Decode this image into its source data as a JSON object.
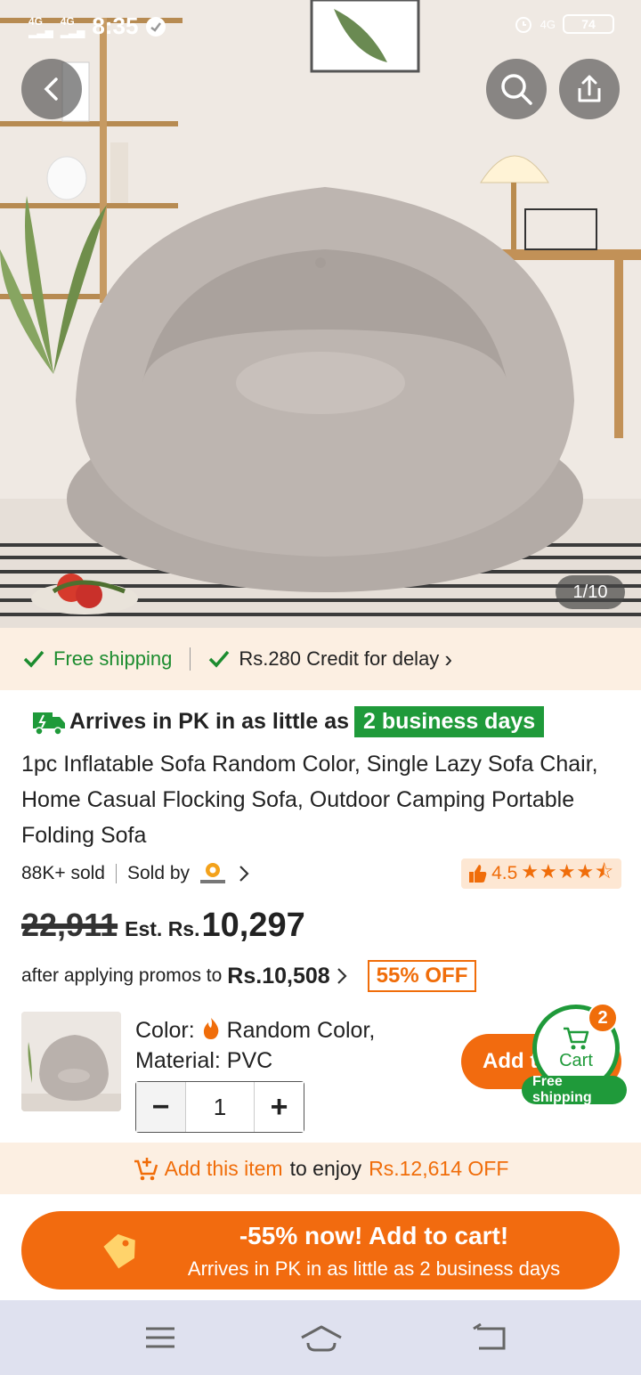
{
  "status_bar": {
    "signal_1": "4G",
    "signal_2": "4G",
    "time": "8:35",
    "network_right": "4G",
    "battery": "74"
  },
  "gallery": {
    "counter": "1/10"
  },
  "shipping_strip": {
    "free_shipping": "Free shipping",
    "credit": "Rs.280 Credit for delay",
    "chevron": "›"
  },
  "product": {
    "arrives_text": "Arrives in PK in as little as",
    "arrives_badge": "2 business days",
    "title": "1pc Inflatable Sofa Random Color, Single Lazy Sofa Chair, Home Casual Flocking Sofa, Outdoor Camping Portable Folding Sofa",
    "sold": "88K+ sold",
    "sold_by": "Sold by",
    "rating": "4.5",
    "stars": "★★★★⯪",
    "old_price": "22,911",
    "est_label": "Est. Rs.",
    "new_price": "10,297",
    "promo_text": "after applying promos to",
    "promo_price": "Rs.10,508",
    "discount_badge": "55% OFF"
  },
  "variant": {
    "color_label": "Color:",
    "color_value": "Random Color,",
    "material": "Material: PVC",
    "quantity": "1",
    "minus": "−",
    "plus": "+",
    "add_button": "Add t",
    "cart_label": "Cart",
    "cart_count": "2",
    "free_shipping_pill": "Free shipping"
  },
  "add_item_strip": {
    "link": "Add this item",
    "middle": "to enjoy",
    "amount": "Rs.12,614 OFF"
  },
  "cta": {
    "main": "-55% now! Add to cart!",
    "sub": "Arrives in PK in as little as 2 business days"
  },
  "colors": {
    "accent_orange": "#f26b0f",
    "green": "#1f9a3a",
    "strip_bg": "#fcefe2"
  }
}
